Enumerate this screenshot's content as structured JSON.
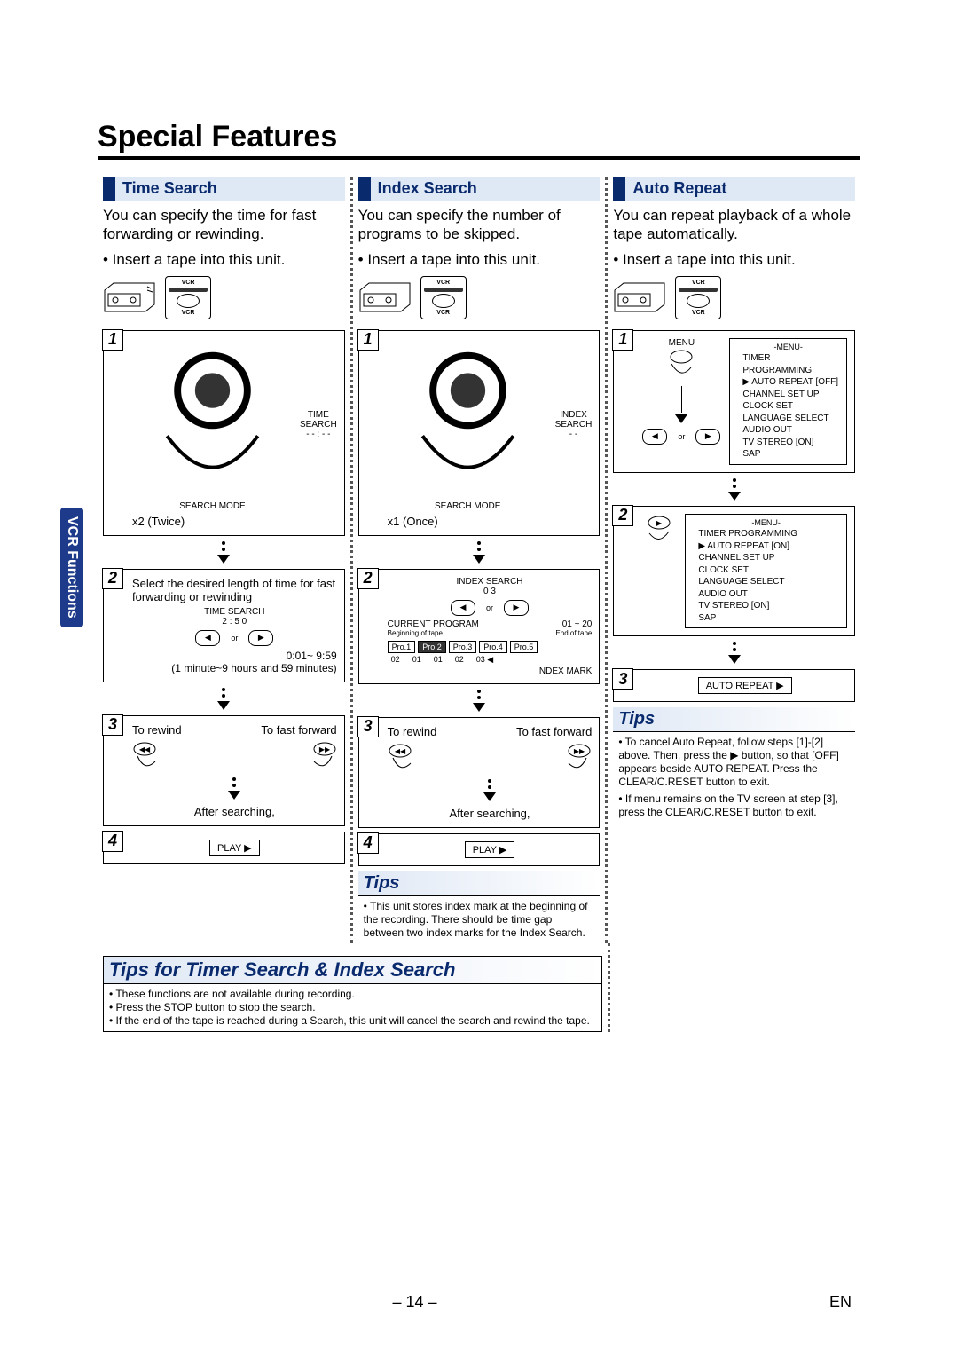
{
  "pageTitle": "Special Features",
  "sideTab": "VCR Functions",
  "pageNumber": "– 14 –",
  "langTag": "EN",
  "common": {
    "insertTape": "• Insert a tape into this unit.",
    "afterSearching": "After searching,",
    "play": "PLAY ▶",
    "toRewind": "To rewind",
    "toFastForward": "To fast forward",
    "or": "or",
    "vcrTv": "VCR"
  },
  "timeSearch": {
    "heading": "Time Search",
    "intro": "You can specify the time for fast forwarding or rewinding.",
    "step1Label": "TIME SEARCH",
    "step1Sub": "SEARCH MODE",
    "step1Hint": "x2 (Twice)",
    "step2Text": "Select the desired length of time for fast forwarding or rewinding",
    "step2Display": "TIME SEARCH",
    "step2Value": "2 : 5 0",
    "step2Range": "0:01~ 9:59",
    "step2RangeNote": "(1 minute~9 hours and 59 minutes)"
  },
  "indexSearch": {
    "heading": "Index Search",
    "intro": "You can specify the number of programs to be skipped.",
    "step1Label": "INDEX SEARCH",
    "step1Sub": "SEARCH MODE",
    "step1Hint": "x1 (Once)",
    "step2Label": "INDEX SEARCH",
    "step2Value": "0 3",
    "range": "01 ~ 20",
    "currentProgram": "CURRENT PROGRAM",
    "beginLabel": "Beginning of tape",
    "endLabel": "End of tape",
    "pros": [
      "Pro.1",
      "Pro.2",
      "Pro.3",
      "Pro.4",
      "Pro.5"
    ],
    "nums": [
      "02",
      "01",
      "01",
      "02",
      "03 ◀"
    ],
    "indexMark": "INDEX MARK",
    "tipsHead": "Tips",
    "tipsBody": "• This unit stores index mark at the beginning of the recording. There should be time gap between two index marks for the Index Search."
  },
  "autoRepeat": {
    "heading": "Auto Repeat",
    "intro": "You can repeat playback of a whole tape automatically.",
    "menuTitle": "-MENU-",
    "menuLines1": [
      "TIMER PROGRAMMING",
      "▶ AUTO REPEAT   [OFF]",
      "CHANNEL SET UP",
      "CLOCK SET",
      "LANGUAGE SELECT",
      "AUDIO OUT",
      "TV STEREO        [ON]",
      "SAP"
    ],
    "menuLines2": [
      "TIMER PROGRAMMING",
      "▶ AUTO REPEAT   [ON]",
      "CHANNEL SET UP",
      "CLOCK SET",
      "LANGUAGE SELECT",
      "AUDIO OUT",
      "TV STEREO        [ON]",
      "SAP"
    ],
    "menuBtn": "MENU",
    "step3Tag": "AUTO REPEAT ▶",
    "tipsHead": "Tips",
    "tips": [
      "• To cancel Auto Repeat, follow steps [1]-[2] above. Then, press the ▶ button, so that [OFF] appears beside AUTO REPEAT.  Press the CLEAR/C.RESET button to exit.",
      "• If menu remains on the TV screen at step [3], press the CLEAR/C.RESET button to exit."
    ]
  },
  "bottomTips": {
    "heading": "Tips for Timer Search & Index Search",
    "lines": [
      "• These functions are not available during recording.",
      "• Press the STOP button to stop the search.",
      "• If the end of the tape is reached during a Search, this unit will cancel the search and rewind the tape."
    ]
  }
}
